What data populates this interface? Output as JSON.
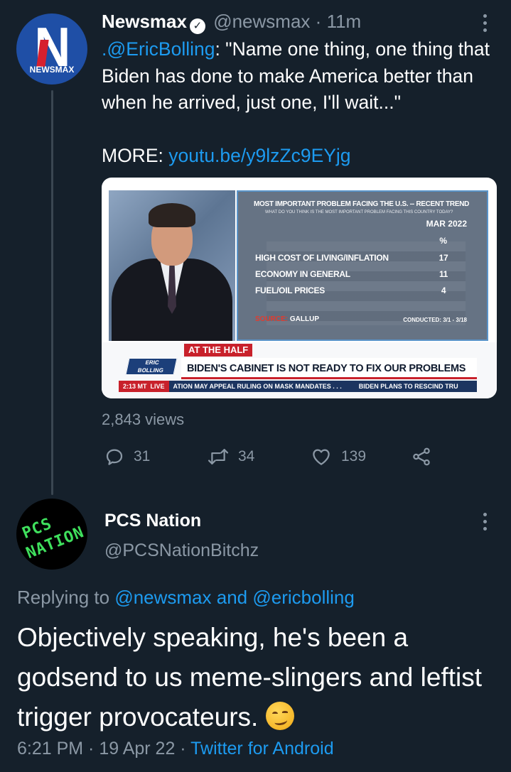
{
  "tweet1": {
    "display_name": "Newsmax",
    "handle": "@newsmax",
    "separator": "·",
    "time": "11m",
    "avatar_label": "NEWSMAX",
    "avatar_letter": "N",
    "text_mention": ".@EricBolling",
    "text_body": ": \"Name one thing, one thing that Biden has done to make America better than when he arrived, just one, I'll wait...\"",
    "more_label": "MORE: ",
    "more_link": "youtu.be/y9lzZc9EYjg",
    "views": "2,843 views",
    "actions": {
      "reply_count": "31",
      "retweet_count": "34",
      "like_count": "139"
    },
    "video": {
      "graphic_title": "MOST IMPORTANT PROBLEM FACING THE U.S. -- RECENT TREND",
      "graphic_subtitle": "WHAT DO YOU THINK IS THE MOST IMPORTANT PROBLEM FACING THIS COUNTRY TODAY?",
      "column_header": "MAR 2022",
      "unit_header": "%",
      "rows": [
        {
          "label": "HIGH COST OF LIVING/INFLATION",
          "value": "17"
        },
        {
          "label": "ECONOMY IN GENERAL",
          "value": "11"
        },
        {
          "label": "FUEL/OIL PRICES",
          "value": "4"
        }
      ],
      "source_label": "SOURCE:",
      "source_value": "GALLUP",
      "conducted": "CONDUCTED: 3/1 - 3/18",
      "segment_tag": "AT THE HALF",
      "show_logo_line1": "ERIC",
      "show_logo_line2": "BOLLING",
      "show_logo_line3": "THE BALANCE",
      "headline": "BIDEN'S CABINET IS NOT READY TO FIX OUR PROBLEMS",
      "ticker_time": "2:13 MT",
      "ticker_live": "LIVE",
      "ticker_item1": "ATION MAY APPEAL RULING ON MASK MANDATES . . .",
      "ticker_item2": "BIDEN PLANS TO RESCIND TRU"
    }
  },
  "tweet2": {
    "display_name": "PCS Nation",
    "handle": "@PCSNationBitchz",
    "avatar_line1": "PCS",
    "avatar_line2": "NATION",
    "replying_prefix": "Replying to ",
    "replying_to1": "@newsmax",
    "replying_and": " and ",
    "replying_to2": "@ericbolling",
    "text": "Objectively speaking, he's been a godsend to us meme-slingers and leftist trigger provocateurs.",
    "time": "6:21 PM",
    "separator": " · ",
    "date": "19 Apr 22",
    "client": "Twitter for Android"
  },
  "colors": {
    "background": "#15202b",
    "link": "#1d9bf0",
    "muted": "#8b98a5"
  },
  "icons": [
    "newsmax-avatar",
    "verified-badge-icon",
    "more-icon",
    "reply-icon",
    "retweet-icon",
    "like-icon",
    "share-icon",
    "smirk-emoji-icon"
  ]
}
